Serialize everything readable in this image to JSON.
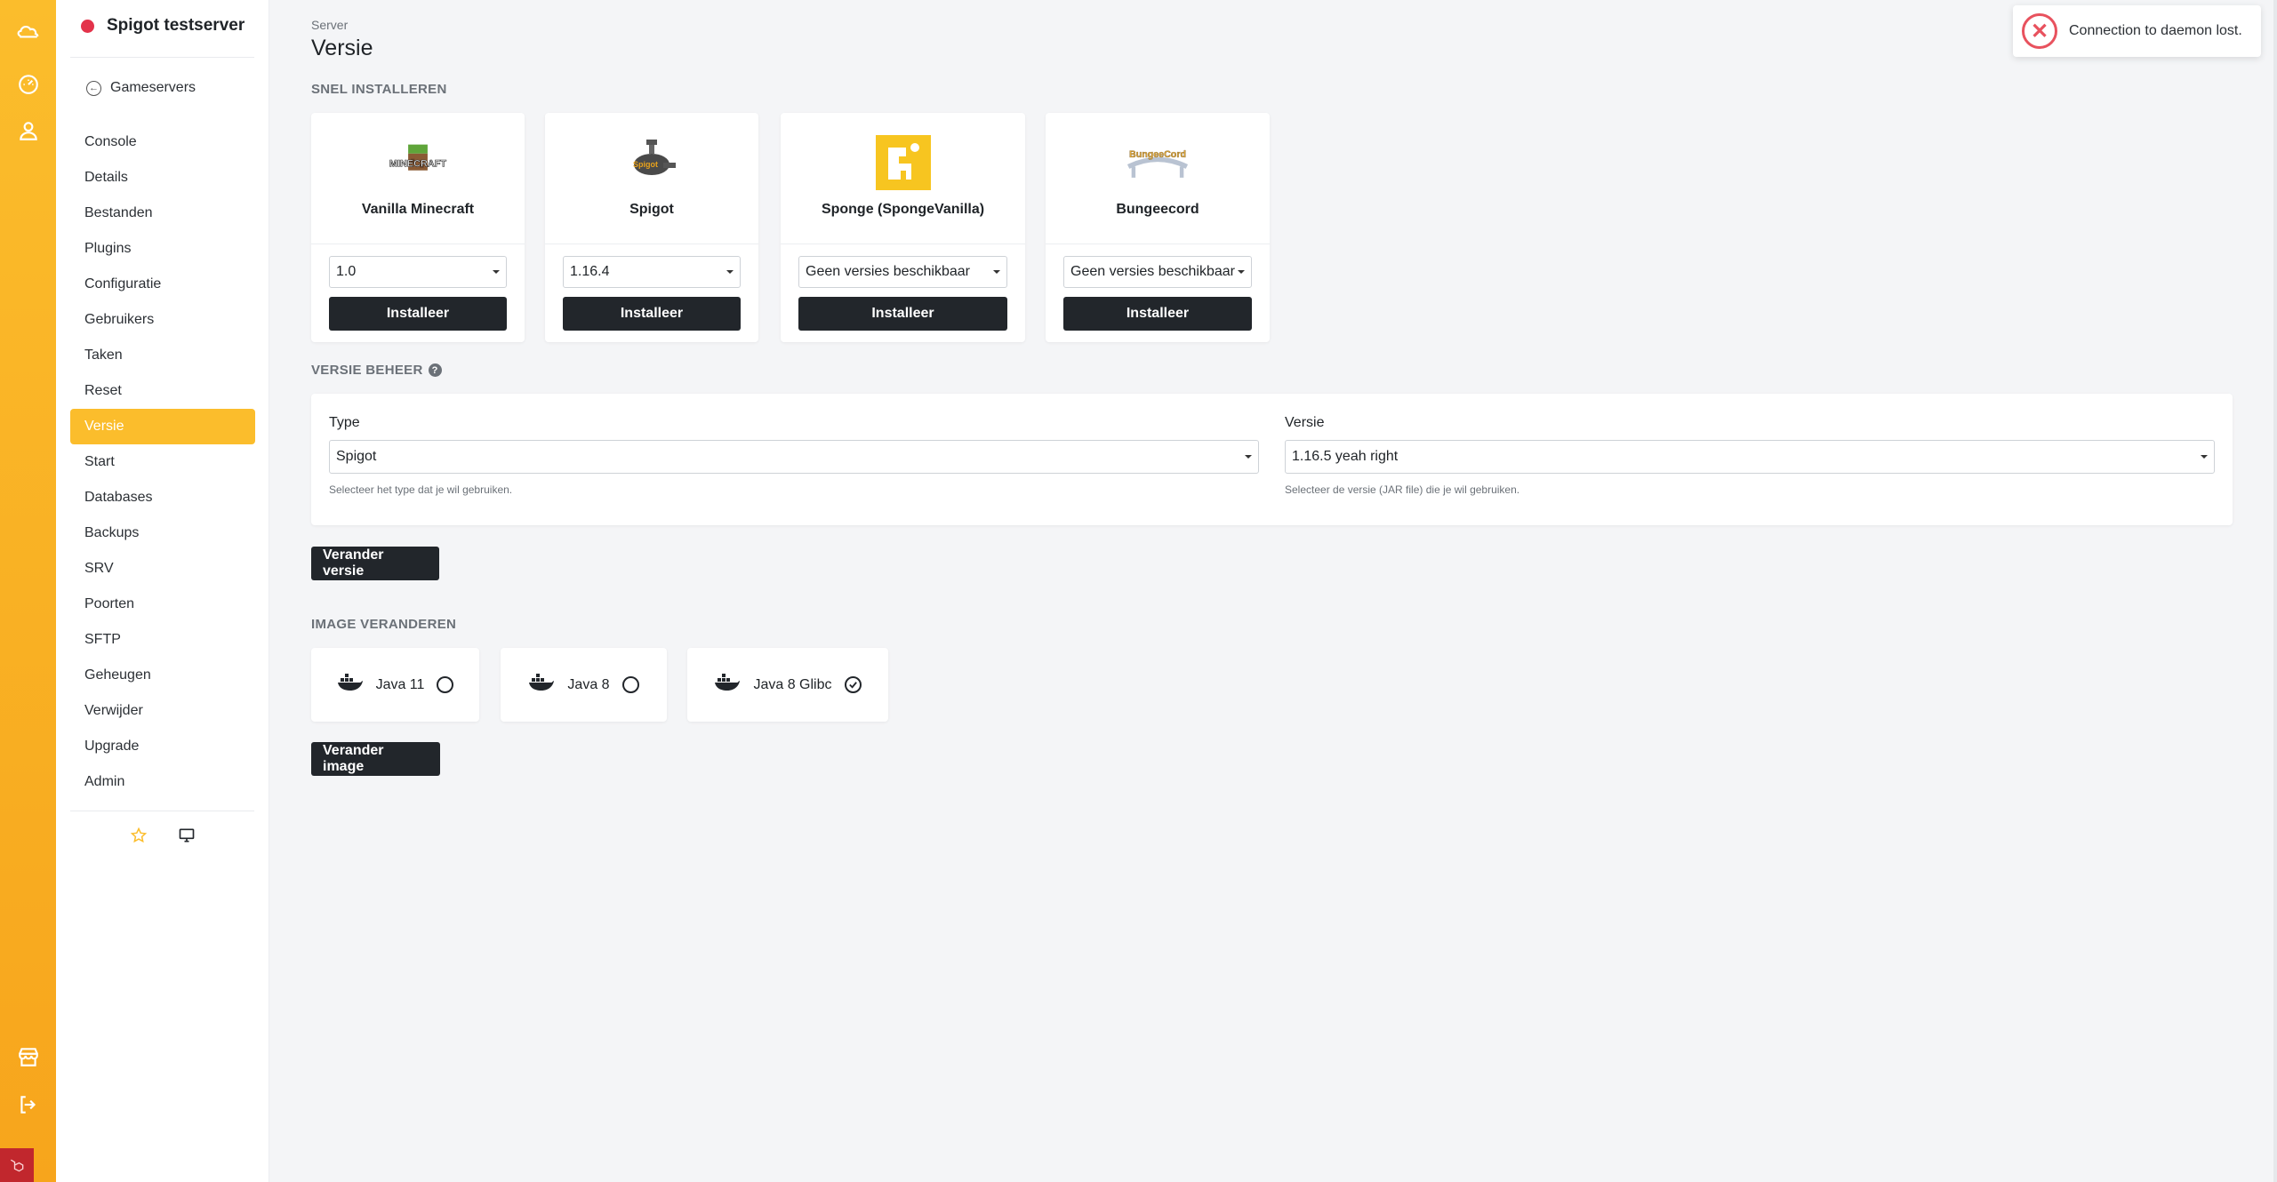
{
  "rail": {
    "icons": [
      "cloud-icon",
      "dashboard-icon",
      "user-icon",
      "store-icon",
      "logout-icon"
    ]
  },
  "sidebar": {
    "server_name": "Spigot testserver",
    "back_label": "Gameservers",
    "items": [
      {
        "label": "Console"
      },
      {
        "label": "Details"
      },
      {
        "label": "Bestanden"
      },
      {
        "label": "Plugins"
      },
      {
        "label": "Configuratie"
      },
      {
        "label": "Gebruikers"
      },
      {
        "label": "Taken"
      },
      {
        "label": "Reset"
      },
      {
        "label": "Versie",
        "active": true
      },
      {
        "label": "Start"
      },
      {
        "label": "Databases"
      },
      {
        "label": "Backups"
      },
      {
        "label": "SRV"
      },
      {
        "label": "Poorten"
      },
      {
        "label": "SFTP"
      },
      {
        "label": "Geheugen"
      },
      {
        "label": "Verwijder"
      },
      {
        "label": "Upgrade"
      },
      {
        "label": "Admin"
      }
    ]
  },
  "header": {
    "breadcrumb": "Server",
    "title": "Versie"
  },
  "quick_install": {
    "label": "SNEL INSTALLEREN",
    "cards": [
      {
        "name": "Vanilla Minecraft",
        "selected": "1.0",
        "button": "Installeer",
        "logo_text": "MINECRAFT"
      },
      {
        "name": "Spigot",
        "selected": "1.16.4",
        "button": "Installeer",
        "logo_text": "Spigot"
      },
      {
        "name": "Sponge (SpongeVanilla)",
        "selected": "Geen versies beschikbaar",
        "button": "Installeer"
      },
      {
        "name": "Bungeecord",
        "selected": "Geen versies beschikbaar",
        "button": "Installeer",
        "logo_text": "BungeeCord"
      }
    ]
  },
  "version_manage": {
    "label": "VERSIE BEHEER",
    "type_label": "Type",
    "type_value": "Spigot",
    "type_help": "Selecteer het type dat je wil gebruiken.",
    "version_label": "Versie",
    "version_value": "1.16.5 yeah right",
    "version_help": "Selecteer de versie (JAR file) die je wil gebruiken.",
    "button": "Verander versie"
  },
  "image_change": {
    "label": "IMAGE VERANDEREN",
    "options": [
      {
        "label": "Java 11",
        "selected": false
      },
      {
        "label": "Java 8",
        "selected": false
      },
      {
        "label": "Java 8 Glibc",
        "selected": true
      }
    ],
    "button": "Verander image"
  },
  "toast": {
    "message": "Connection to daemon lost."
  },
  "colors": {
    "accent": "#fbbd2c",
    "dark_button": "#22262b",
    "status_offline": "#e3334a",
    "error": "#e8525e"
  }
}
